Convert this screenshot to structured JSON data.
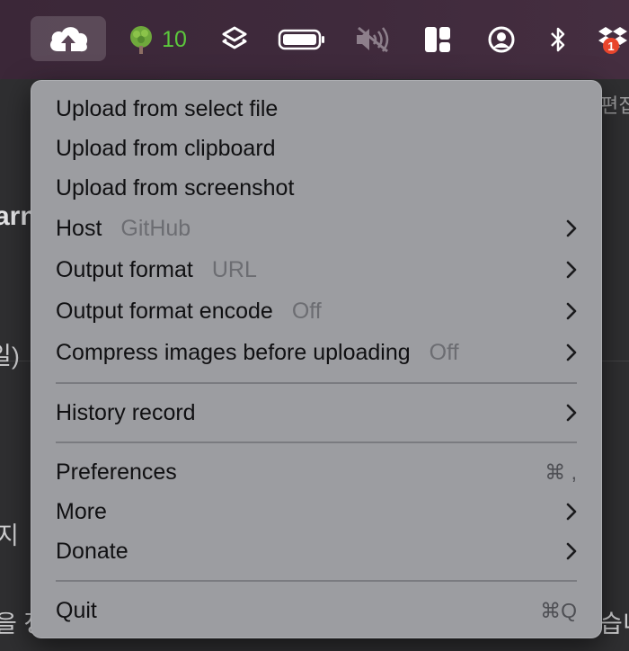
{
  "menubar": {
    "app_icon": "cloud-upload-icon",
    "forest_count": "10",
    "icons": [
      "cloud-upload-icon",
      "tree-icon",
      "layers-icon",
      "battery-icon",
      "speaker-muted-icon",
      "layout-icon",
      "user-circle-icon",
      "bluetooth-icon",
      "dropbox-icon"
    ],
    "dropbox_badge": "1"
  },
  "background": {
    "top_right_text": "편집",
    "left_fragment_1": "arn",
    "left_fragment_2": "일)",
    "left_fragment_3": "지",
    "left_fragment_4": "을 정",
    "right_fragment": "습니"
  },
  "menu": {
    "upload_file": "Upload from select file",
    "upload_clipboard": "Upload from clipboard",
    "upload_screenshot": "Upload from screenshot",
    "host_label": "Host",
    "host_value": "GitHub",
    "output_format_label": "Output format",
    "output_format_value": "URL",
    "output_encode_label": "Output format encode",
    "output_encode_value": "Off",
    "compress_label": "Compress images before uploading",
    "compress_value": "Off",
    "history_label": "History record",
    "preferences_label": "Preferences",
    "preferences_shortcut": "⌘ ,",
    "more_label": "More",
    "donate_label": "Donate",
    "quit_label": "Quit",
    "quit_shortcut": "⌘Q"
  },
  "colors": {
    "menubar_bg": "#3f2a3c",
    "menu_bg": "#9c9da1",
    "accent_green": "#5cc83c",
    "badge_red": "#e8452c"
  }
}
